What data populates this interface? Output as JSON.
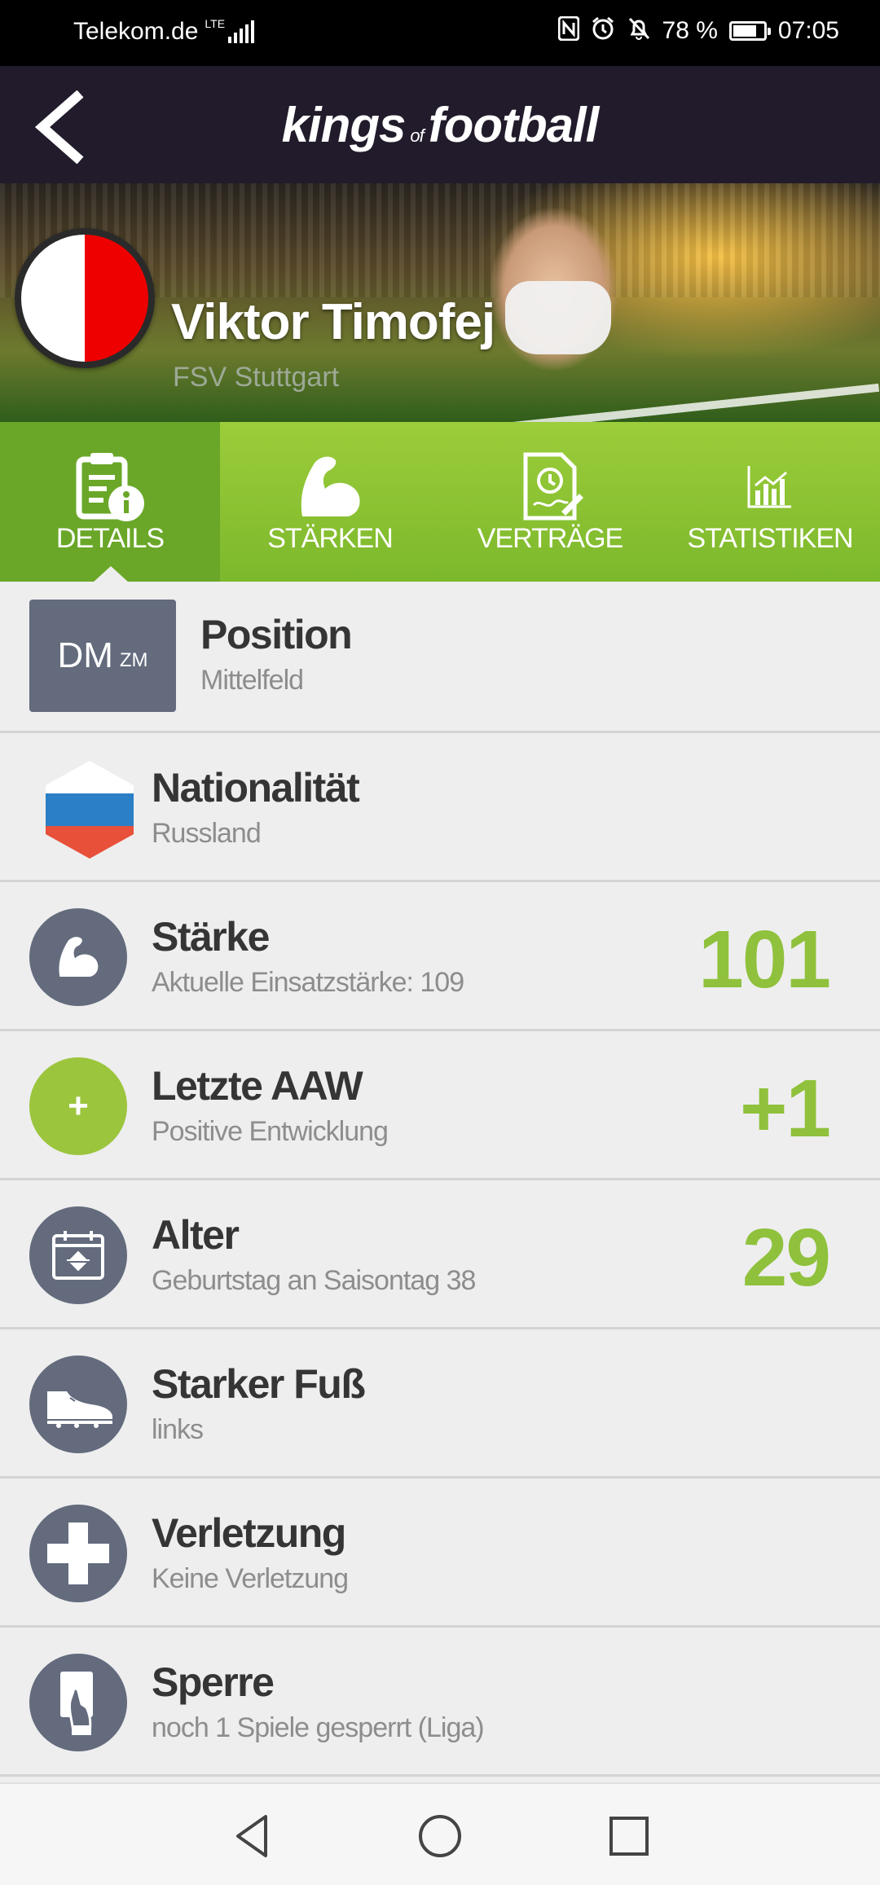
{
  "status_bar": {
    "carrier": "Telekom.de",
    "network": "LTE",
    "battery_percent": "78 %",
    "battery_level": 0.78,
    "time": "07:05",
    "icons": [
      "nfc-icon",
      "alarm-icon",
      "bell-off-icon",
      "battery-icon"
    ]
  },
  "header": {
    "logo_part1": "kings",
    "logo_part2": "of",
    "logo_part3": "football",
    "back_icon": "back-arrow-icon"
  },
  "player": {
    "name": "Viktor Timofej",
    "club": "FSV Stuttgart",
    "badge_colors": [
      "#ffffff",
      "#ee0000"
    ]
  },
  "tabs": [
    {
      "label": "DETAILS",
      "icon": "clipboard-info-icon",
      "active": true
    },
    {
      "label": "STÄRKEN",
      "icon": "flexed-arm-icon",
      "active": false
    },
    {
      "label": "VERTRÄGE",
      "icon": "contract-icon",
      "active": false
    },
    {
      "label": "STATISTIKEN",
      "icon": "bar-chart-icon",
      "active": false
    }
  ],
  "details": {
    "position": {
      "main": "DM",
      "secondary": "ZM",
      "title": "Position",
      "subtitle": "Mittelfeld"
    },
    "nationality": {
      "title": "Nationalität",
      "subtitle": "Russland",
      "flag_colors": [
        "#ffffff",
        "#2b7fc6",
        "#e8503a"
      ]
    },
    "strength": {
      "title": "Stärke",
      "subtitle": "Aktuelle Einsatzstärke: 109",
      "value": "101"
    },
    "last_aaw": {
      "title": "Letzte AAW",
      "subtitle": "Positive Entwicklung",
      "value": "+1",
      "badge": "+"
    },
    "age": {
      "title": "Alter",
      "subtitle": "Geburtstag an Saisontag 38",
      "value": "29"
    },
    "strong_foot": {
      "title": "Starker Fuß",
      "subtitle": "links"
    },
    "injury": {
      "title": "Verletzung",
      "subtitle": "Keine Verletzung"
    },
    "suspension": {
      "title": "Sperre",
      "subtitle": "noch 1 Spiele gesperrt (Liga)"
    }
  },
  "colors": {
    "accent_green": "#8fc13c",
    "tab_green": "#7cb82c",
    "header_dark": "#221b2b",
    "icon_slate": "#636b7d"
  },
  "nav": [
    "back-triangle-icon",
    "home-circle-icon",
    "recents-square-icon"
  ]
}
